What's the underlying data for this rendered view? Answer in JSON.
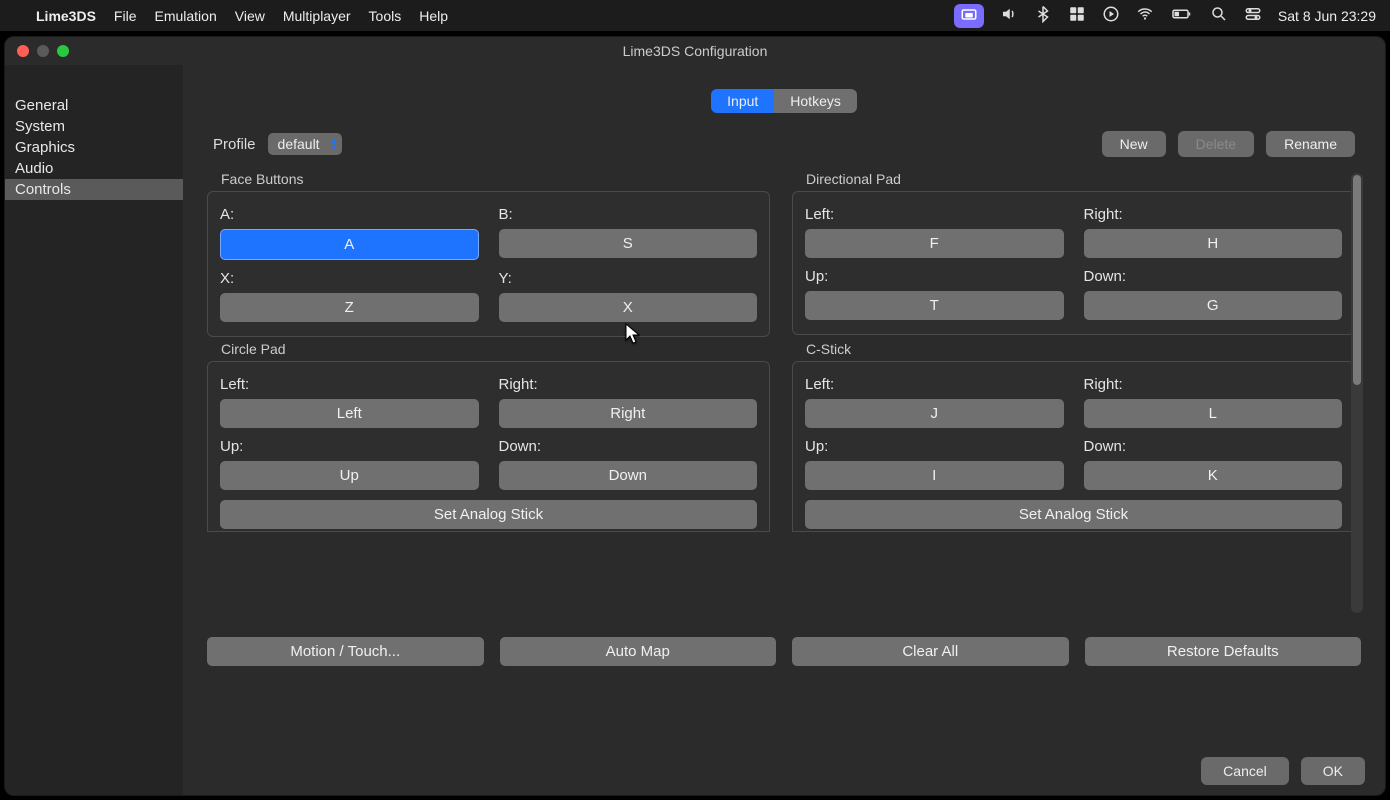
{
  "menubar": {
    "app": "Lime3DS",
    "items": [
      "File",
      "Emulation",
      "View",
      "Multiplayer",
      "Tools",
      "Help"
    ],
    "clock": "Sat 8 Jun  23:29"
  },
  "window": {
    "title": "Lime3DS Configuration"
  },
  "sidebar": {
    "items": [
      "General",
      "System",
      "Graphics",
      "Audio",
      "Controls"
    ],
    "selected": "Controls"
  },
  "tabs": {
    "input": "Input",
    "hotkeys": "Hotkeys",
    "active": "Input"
  },
  "profile": {
    "label": "Profile",
    "selected": "default",
    "btn_new": "New",
    "btn_delete": "Delete",
    "btn_rename": "Rename"
  },
  "groups": {
    "face": {
      "title": "Face Buttons",
      "a": {
        "label": "A:",
        "value": "A"
      },
      "b": {
        "label": "B:",
        "value": "S"
      },
      "x": {
        "label": "X:",
        "value": "Z"
      },
      "y": {
        "label": "Y:",
        "value": "X"
      }
    },
    "dpad": {
      "title": "Directional Pad",
      "left": {
        "label": "Left:",
        "value": "F"
      },
      "right": {
        "label": "Right:",
        "value": "H"
      },
      "up": {
        "label": "Up:",
        "value": "T"
      },
      "down": {
        "label": "Down:",
        "value": "G"
      }
    },
    "circle": {
      "title": "Circle Pad",
      "left": {
        "label": "Left:",
        "value": "Left"
      },
      "right": {
        "label": "Right:",
        "value": "Right"
      },
      "up": {
        "label": "Up:",
        "value": "Up"
      },
      "down": {
        "label": "Down:",
        "value": "Down"
      },
      "analog": "Set Analog Stick"
    },
    "cstick": {
      "title": "C-Stick",
      "left": {
        "label": "Left:",
        "value": "J"
      },
      "right": {
        "label": "Right:",
        "value": "L"
      },
      "up": {
        "label": "Up:",
        "value": "I"
      },
      "down": {
        "label": "Down:",
        "value": "K"
      },
      "analog": "Set Analog Stick"
    }
  },
  "actions": {
    "motion": "Motion / Touch...",
    "automap": "Auto Map",
    "clear": "Clear All",
    "restore": "Restore Defaults"
  },
  "footer": {
    "cancel": "Cancel",
    "ok": "OK"
  }
}
